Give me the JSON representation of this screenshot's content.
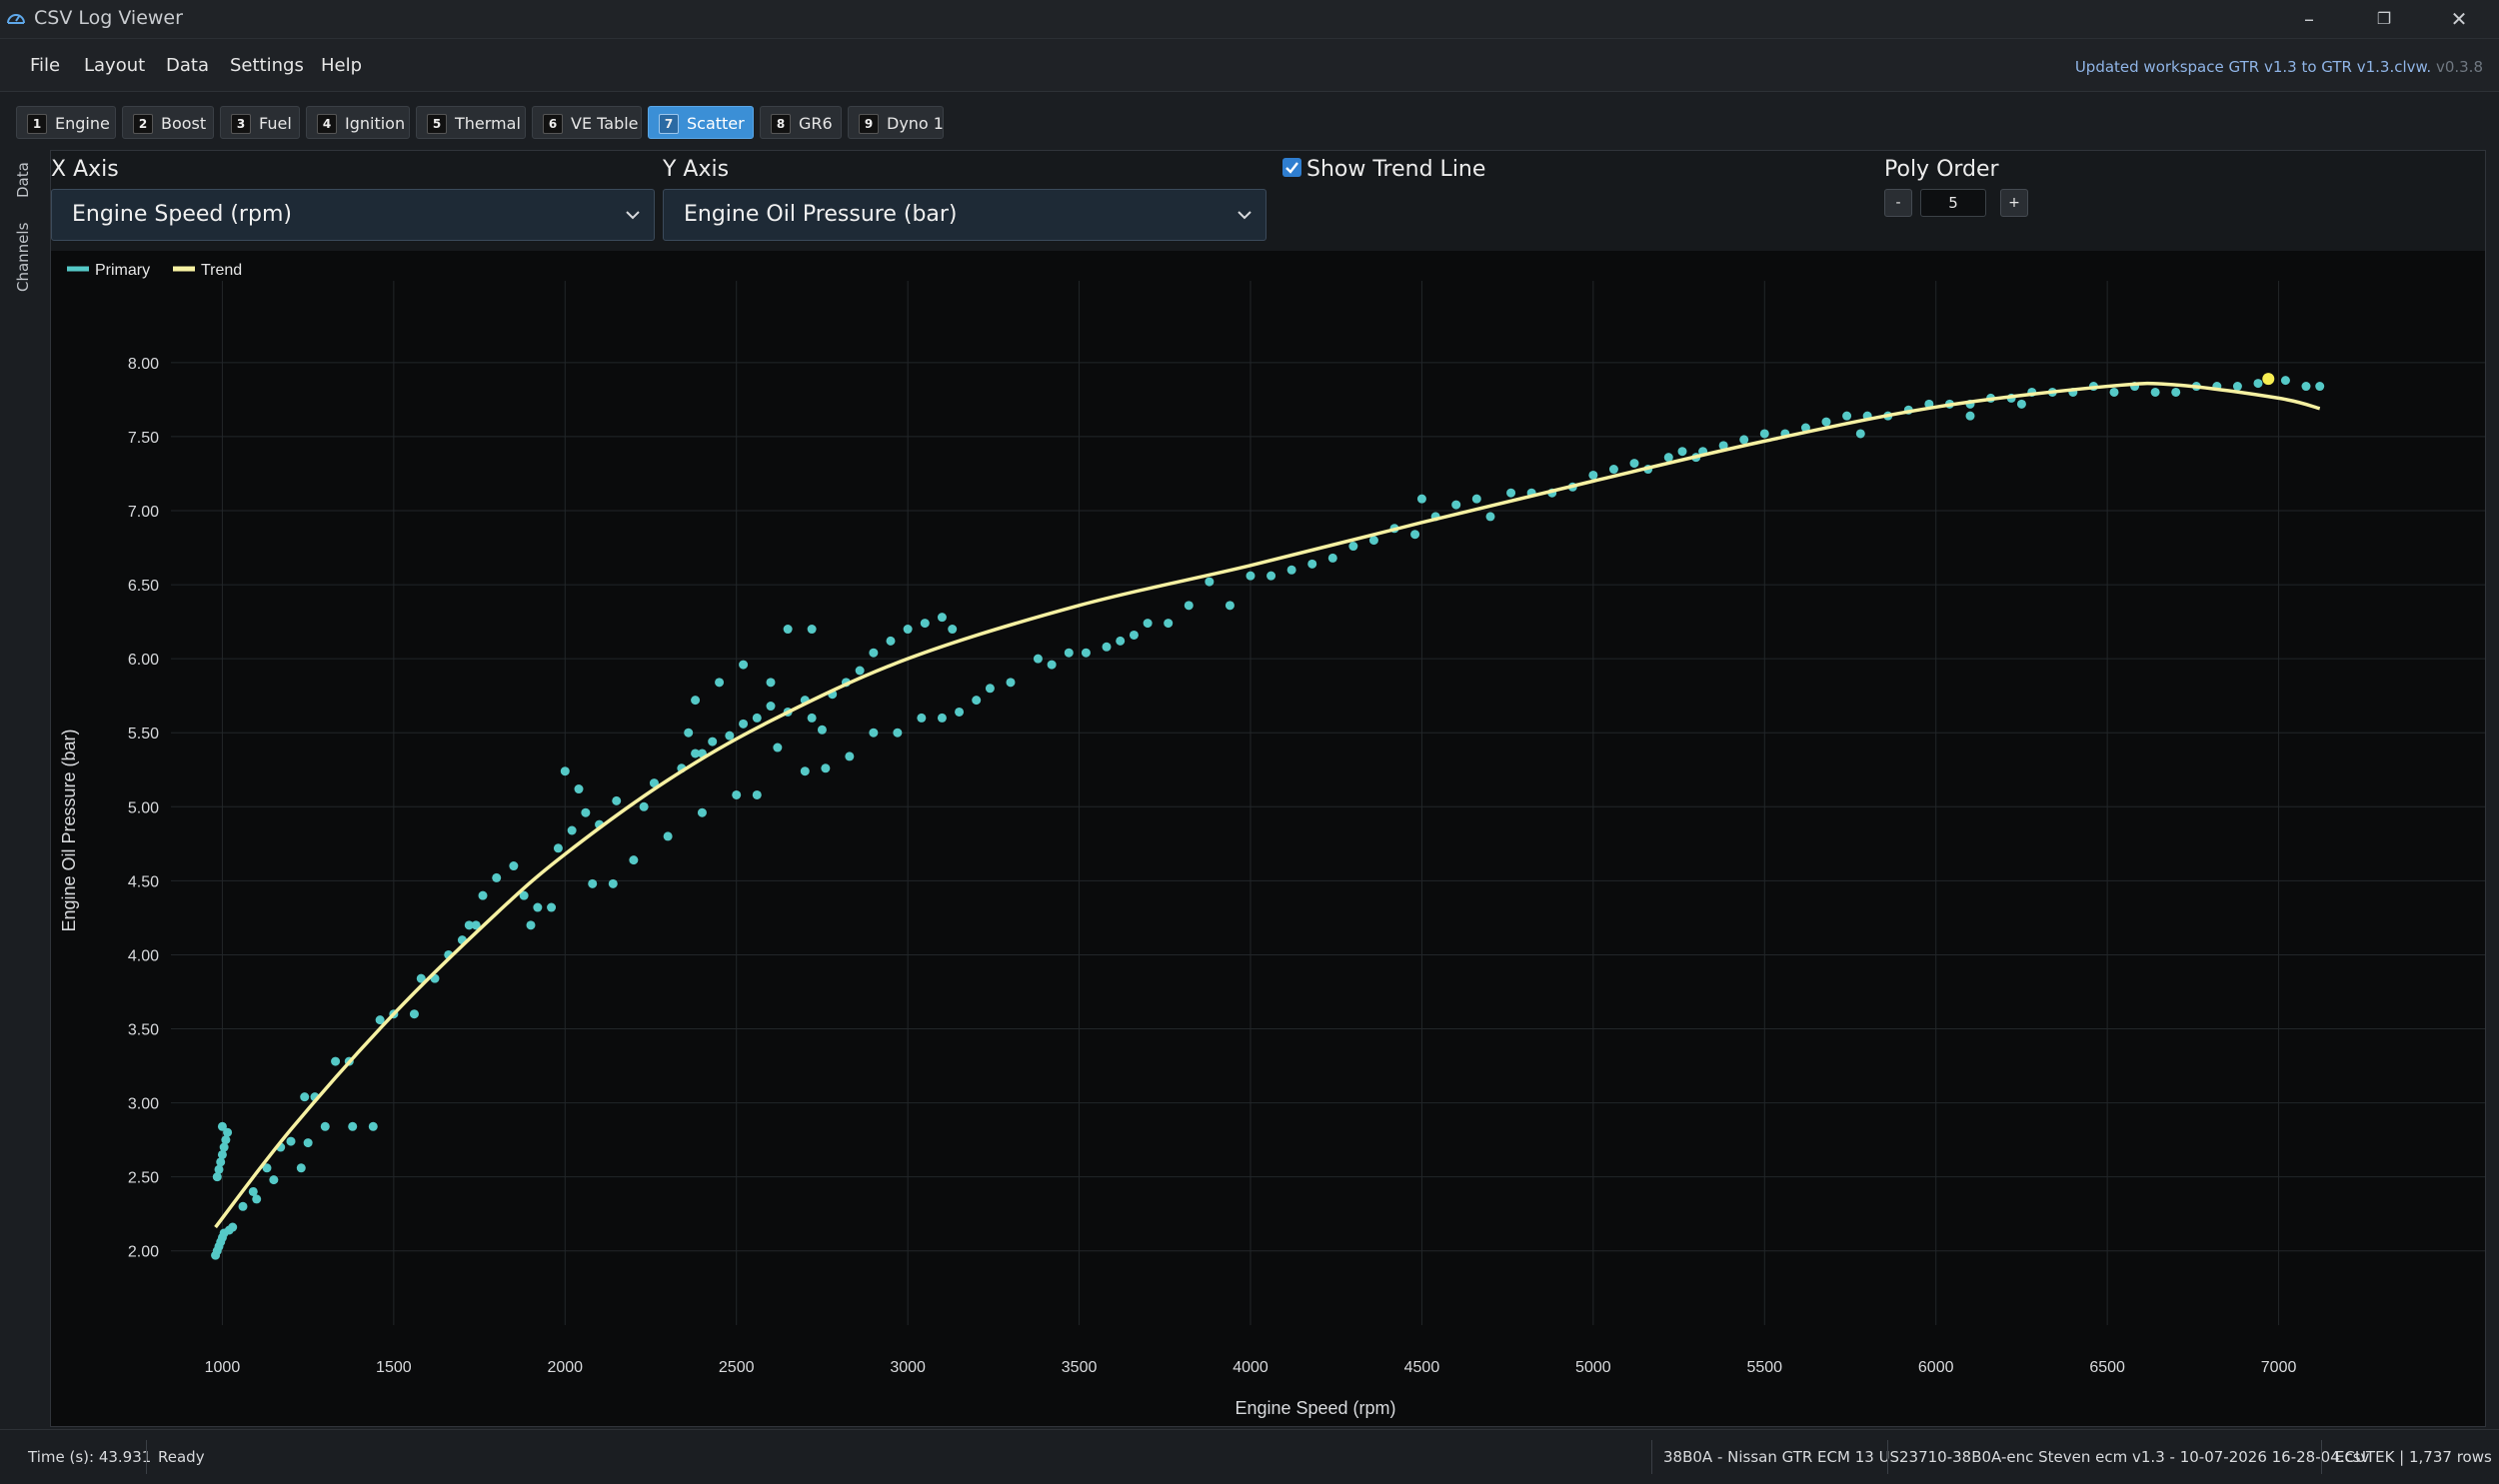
{
  "app": {
    "title": "CSV Log Viewer"
  },
  "menu": {
    "items": [
      "File",
      "Layout",
      "Data",
      "Settings",
      "Help"
    ],
    "workspace_note": "Updated workspace GTR v1.3 to GTR v1.3.clvw.",
    "version": "v0.3.8"
  },
  "tabs": [
    {
      "num": "1",
      "label": "Engine"
    },
    {
      "num": "2",
      "label": "Boost"
    },
    {
      "num": "3",
      "label": "Fuel"
    },
    {
      "num": "4",
      "label": "Ignition"
    },
    {
      "num": "5",
      "label": "Thermal"
    },
    {
      "num": "6",
      "label": "VE Table"
    },
    {
      "num": "7",
      "label": "Scatter"
    },
    {
      "num": "8",
      "label": "GR6"
    },
    {
      "num": "9",
      "label": "Dyno 1"
    }
  ],
  "active_tab": "Scatter",
  "side_tabs": [
    "Data",
    "Channels"
  ],
  "controls": {
    "x_axis_title": "X Axis",
    "x_axis_value": "Engine Speed (rpm)",
    "y_axis_title": "Y Axis",
    "y_axis_value": "Engine Oil Pressure (bar)",
    "show_trend_label": "Show Trend Line",
    "show_trend_checked": true,
    "poly_order_title": "Poly Order",
    "poly_minus": "-",
    "poly_value": "5",
    "poly_plus": "+"
  },
  "chart_data": {
    "type": "scatter",
    "xlabel": "Engine Speed (rpm)",
    "ylabel": "Engine Oil Pressure (bar)",
    "xlim": [
      850,
      7500
    ],
    "ylim": [
      1.6,
      8.35
    ],
    "x_ticks": [
      "1000",
      "1500",
      "2000",
      "2500",
      "3000",
      "3500",
      "4000",
      "4500",
      "5000",
      "5500",
      "6000",
      "6500",
      "7000"
    ],
    "y_ticks": [
      "2.00",
      "2.50",
      "3.00",
      "3.50",
      "4.00",
      "4.50",
      "5.00",
      "5.50",
      "6.00",
      "6.50",
      "7.00",
      "7.50",
      "8.00"
    ],
    "grid": true,
    "legend_position": "top-left",
    "series": [
      {
        "name": "Primary",
        "color": "#55c9c7",
        "points": [
          [
            980,
            1.97
          ],
          [
            985,
            2.0
          ],
          [
            990,
            2.03
          ],
          [
            995,
            2.06
          ],
          [
            1000,
            2.09
          ],
          [
            1005,
            2.12
          ],
          [
            1020,
            2.14
          ],
          [
            1030,
            2.16
          ],
          [
            985,
            2.5
          ],
          [
            990,
            2.55
          ],
          [
            995,
            2.6
          ],
          [
            1000,
            2.65
          ],
          [
            1005,
            2.7
          ],
          [
            1010,
            2.75
          ],
          [
            1015,
            2.8
          ],
          [
            1000,
            2.84
          ],
          [
            1060,
            2.3
          ],
          [
            1090,
            2.4
          ],
          [
            1100,
            2.35
          ],
          [
            1130,
            2.56
          ],
          [
            1150,
            2.48
          ],
          [
            1170,
            2.7
          ],
          [
            1200,
            2.74
          ],
          [
            1230,
            2.56
          ],
          [
            1250,
            2.73
          ],
          [
            1240,
            3.04
          ],
          [
            1270,
            3.04
          ],
          [
            1330,
            3.28
          ],
          [
            1370,
            3.28
          ],
          [
            1300,
            2.84
          ],
          [
            1380,
            2.84
          ],
          [
            1440,
            2.84
          ],
          [
            1460,
            3.56
          ],
          [
            1500,
            3.6
          ],
          [
            1560,
            3.6
          ],
          [
            1580,
            3.84
          ],
          [
            1620,
            3.84
          ],
          [
            1660,
            4.0
          ],
          [
            1700,
            4.1
          ],
          [
            1720,
            4.2
          ],
          [
            1760,
            4.4
          ],
          [
            1800,
            4.52
          ],
          [
            1850,
            4.6
          ],
          [
            1880,
            4.4
          ],
          [
            1920,
            4.32
          ],
          [
            1960,
            4.32
          ],
          [
            1740,
            4.2
          ],
          [
            1900,
            4.2
          ],
          [
            1980,
            4.72
          ],
          [
            2020,
            4.84
          ],
          [
            2060,
            4.96
          ],
          [
            2100,
            4.88
          ],
          [
            2000,
            5.24
          ],
          [
            2040,
            5.12
          ],
          [
            2080,
            4.48
          ],
          [
            2140,
            4.48
          ],
          [
            2150,
            5.04
          ],
          [
            2200,
            4.64
          ],
          [
            2230,
            5.0
          ],
          [
            2260,
            5.16
          ],
          [
            2300,
            4.8
          ],
          [
            2340,
            5.26
          ],
          [
            2380,
            5.36
          ],
          [
            2400,
            4.96
          ],
          [
            2430,
            5.44
          ],
          [
            2480,
            5.48
          ],
          [
            2520,
            5.56
          ],
          [
            2560,
            5.6
          ],
          [
            2600,
            5.68
          ],
          [
            2650,
            5.64
          ],
          [
            2700,
            5.72
          ],
          [
            2720,
            5.6
          ],
          [
            2750,
            5.52
          ],
          [
            2780,
            5.76
          ],
          [
            2820,
            5.84
          ],
          [
            2860,
            5.92
          ],
          [
            2900,
            6.04
          ],
          [
            2950,
            6.12
          ],
          [
            3000,
            6.2
          ],
          [
            3050,
            6.24
          ],
          [
            3100,
            6.28
          ],
          [
            3130,
            6.2
          ],
          [
            2650,
            6.2
          ],
          [
            2720,
            6.2
          ],
          [
            2520,
            5.96
          ],
          [
            2600,
            5.84
          ],
          [
            2450,
            5.84
          ],
          [
            2380,
            5.72
          ],
          [
            2360,
            5.5
          ],
          [
            2400,
            5.36
          ],
          [
            2500,
            5.08
          ],
          [
            2560,
            5.08
          ],
          [
            2620,
            5.4
          ],
          [
            2700,
            5.24
          ],
          [
            2760,
            5.26
          ],
          [
            2830,
            5.34
          ],
          [
            2900,
            5.5
          ],
          [
            2970,
            5.5
          ],
          [
            3040,
            5.6
          ],
          [
            3100,
            5.6
          ],
          [
            3150,
            5.64
          ],
          [
            3200,
            5.72
          ],
          [
            3240,
            5.8
          ],
          [
            3300,
            5.84
          ],
          [
            3380,
            6.0
          ],
          [
            3420,
            5.96
          ],
          [
            3470,
            6.04
          ],
          [
            3520,
            6.04
          ],
          [
            3580,
            6.08
          ],
          [
            3620,
            6.12
          ],
          [
            3660,
            6.16
          ],
          [
            3700,
            6.24
          ],
          [
            3760,
            6.24
          ],
          [
            3820,
            6.36
          ],
          [
            3880,
            6.52
          ],
          [
            3940,
            6.36
          ],
          [
            4000,
            6.56
          ],
          [
            4060,
            6.56
          ],
          [
            4120,
            6.6
          ],
          [
            4180,
            6.64
          ],
          [
            4240,
            6.68
          ],
          [
            4300,
            6.76
          ],
          [
            4360,
            6.8
          ],
          [
            4420,
            6.88
          ],
          [
            4480,
            6.84
          ],
          [
            4540,
            6.96
          ],
          [
            4600,
            7.04
          ],
          [
            4660,
            7.08
          ],
          [
            4700,
            6.96
          ],
          [
            4760,
            7.12
          ],
          [
            4820,
            7.12
          ],
          [
            4880,
            7.12
          ],
          [
            4940,
            7.16
          ],
          [
            5000,
            7.24
          ],
          [
            5060,
            7.28
          ],
          [
            5120,
            7.32
          ],
          [
            5160,
            7.28
          ],
          [
            5220,
            7.36
          ],
          [
            5260,
            7.4
          ],
          [
            5320,
            7.4
          ],
          [
            5380,
            7.44
          ],
          [
            5440,
            7.48
          ],
          [
            5500,
            7.52
          ],
          [
            5560,
            7.52
          ],
          [
            5620,
            7.56
          ],
          [
            5680,
            7.6
          ],
          [
            5740,
            7.64
          ],
          [
            5800,
            7.64
          ],
          [
            5860,
            7.64
          ],
          [
            5920,
            7.68
          ],
          [
            5980,
            7.72
          ],
          [
            6040,
            7.72
          ],
          [
            6100,
            7.72
          ],
          [
            6160,
            7.76
          ],
          [
            6220,
            7.76
          ],
          [
            6280,
            7.8
          ],
          [
            6340,
            7.8
          ],
          [
            6400,
            7.8
          ],
          [
            6460,
            7.84
          ],
          [
            6520,
            7.8
          ],
          [
            6580,
            7.84
          ],
          [
            6640,
            7.8
          ],
          [
            6700,
            7.8
          ],
          [
            6760,
            7.84
          ],
          [
            6820,
            7.84
          ],
          [
            6880,
            7.84
          ],
          [
            6940,
            7.86
          ],
          [
            7020,
            7.88
          ],
          [
            7080,
            7.84
          ],
          [
            7120,
            7.84
          ],
          [
            4500,
            7.08
          ],
          [
            5300,
            7.36
          ],
          [
            5780,
            7.52
          ],
          [
            6100,
            7.64
          ],
          [
            6250,
            7.72
          ]
        ]
      },
      {
        "name": "Trend",
        "color": "#f6f1a2",
        "polynomial_order": 5,
        "points": [
          [
            980,
            2.16
          ],
          [
            1200,
            2.82
          ],
          [
            1500,
            3.6
          ],
          [
            1800,
            4.28
          ],
          [
            2000,
            4.68
          ],
          [
            2300,
            5.18
          ],
          [
            2600,
            5.58
          ],
          [
            3000,
            6.0
          ],
          [
            3500,
            6.36
          ],
          [
            4000,
            6.63
          ],
          [
            4500,
            6.92
          ],
          [
            5000,
            7.2
          ],
          [
            5500,
            7.47
          ],
          [
            6000,
            7.7
          ],
          [
            6500,
            7.84
          ],
          [
            6700,
            7.85
          ],
          [
            7000,
            7.76
          ],
          [
            7120,
            7.69
          ]
        ]
      }
    ],
    "highlight_point": {
      "x": 6970,
      "y": 7.89,
      "color": "#f7ee52"
    }
  },
  "status": {
    "time_label": "Time (s): 43.931",
    "state": "Ready",
    "ecu": "38B0A - Nissan GTR ECM 13 US",
    "file": "23710-38B0A-enc Steven ecm v1.3 - 10-07-2026 16-28-04.csv",
    "source": "ECUTEK | 1,737 rows"
  }
}
